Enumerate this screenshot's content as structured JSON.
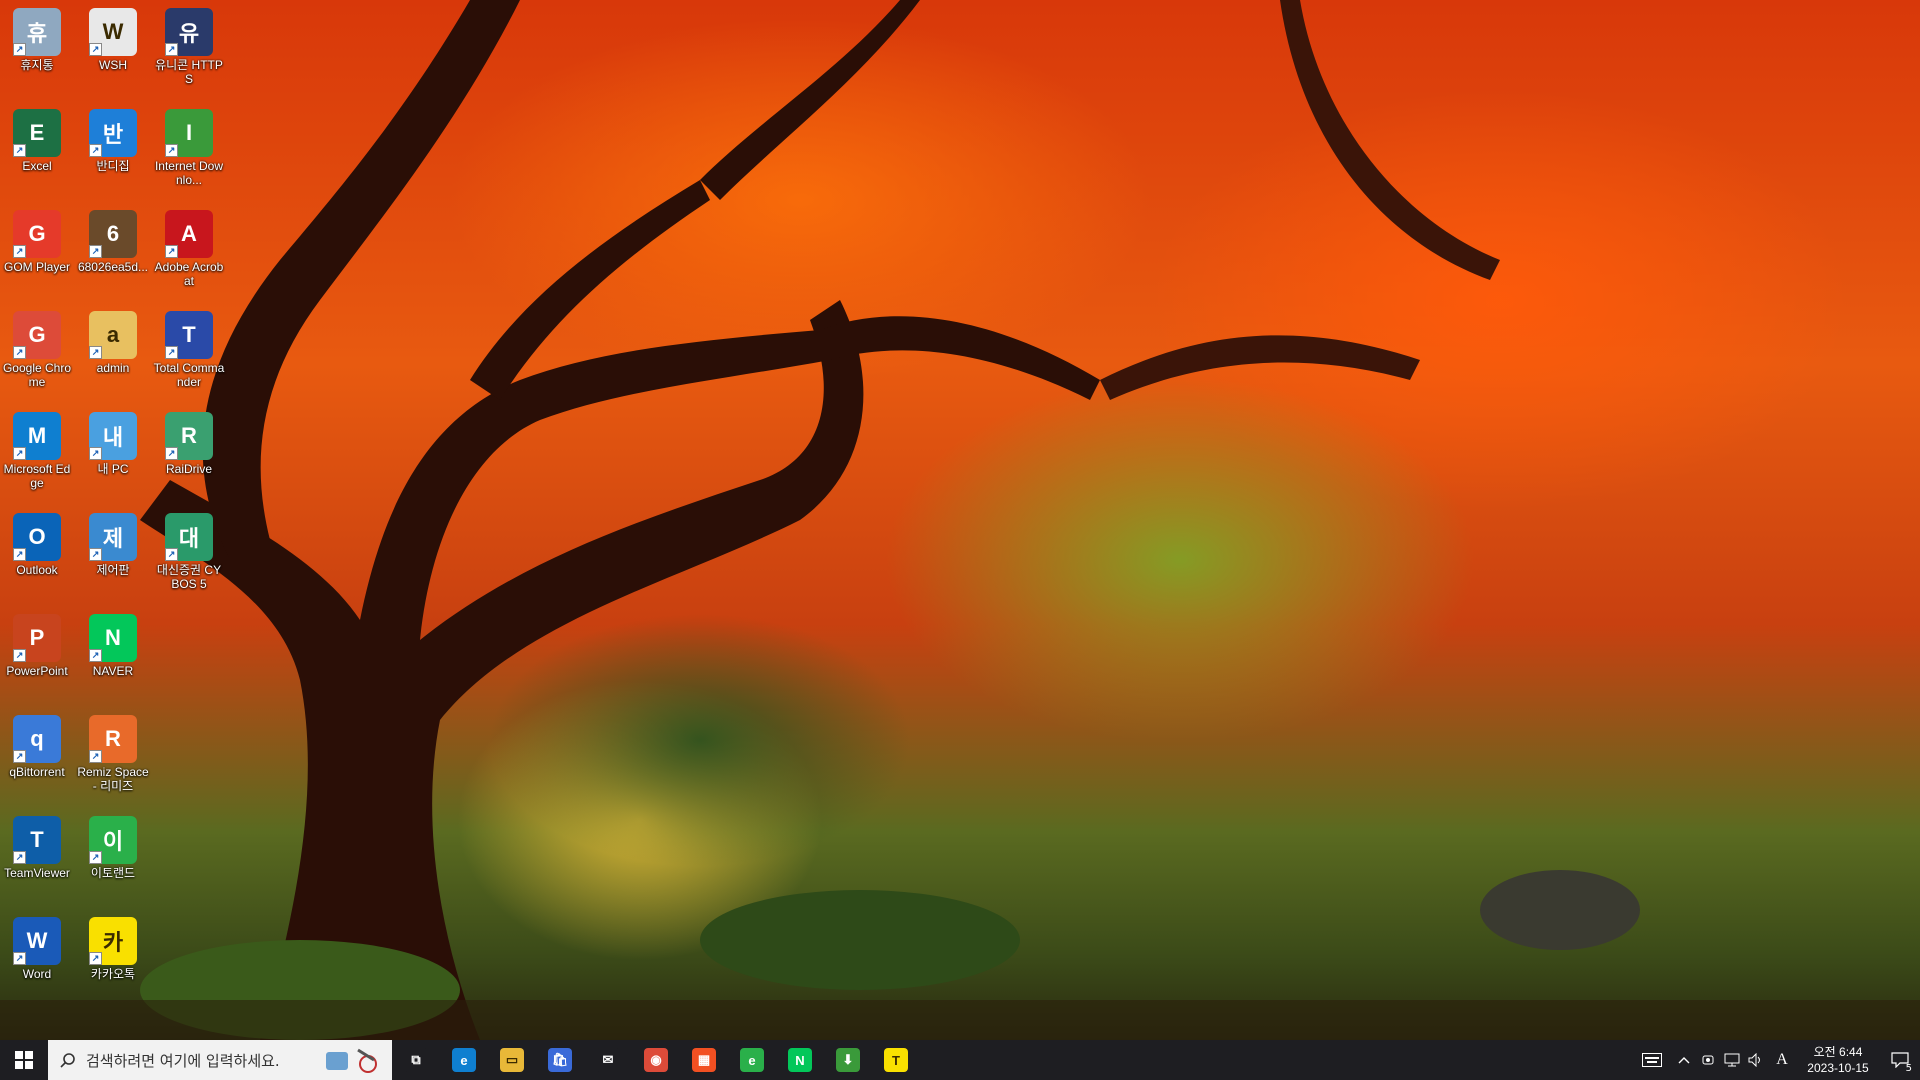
{
  "desktop": {
    "icons": [
      {
        "label": "휴지통",
        "icon": "recycle-bin-icon",
        "color": "#8fa8c0"
      },
      {
        "label": "WSH",
        "icon": "script-icon",
        "color": "#e8e8e8"
      },
      {
        "label": "유니콘 HTTPS",
        "icon": "unicorn-https-icon",
        "color": "#2a3a6a"
      },
      {
        "label": "Excel",
        "icon": "excel-icon",
        "color": "#1d7044"
      },
      {
        "label": "반디집",
        "icon": "bandizip-icon",
        "color": "#1e7fd8"
      },
      {
        "label": "Internet Downlo...",
        "icon": "idm-icon",
        "color": "#3a9a3a"
      },
      {
        "label": "GOM Player",
        "icon": "gom-player-icon",
        "color": "#e53a2a"
      },
      {
        "label": "68026ea5d...",
        "icon": "image-file-icon",
        "color": "#6a4a2a"
      },
      {
        "label": "Adobe Acrobat",
        "icon": "acrobat-icon",
        "color": "#c8161d"
      },
      {
        "label": "Google Chrome",
        "icon": "chrome-icon",
        "color": "#dd4b39"
      },
      {
        "label": "admin",
        "icon": "user-folder-icon",
        "color": "#e8c060"
      },
      {
        "label": "Total Commander",
        "icon": "total-commander-icon",
        "color": "#2a4aa8"
      },
      {
        "label": "Microsoft Edge",
        "icon": "edge-icon",
        "color": "#0f7fd0"
      },
      {
        "label": "내 PC",
        "icon": "this-pc-icon",
        "color": "#4aa0e0"
      },
      {
        "label": "RaiDrive",
        "icon": "raidrive-icon",
        "color": "#3aa070"
      },
      {
        "label": "Outlook",
        "icon": "outlook-icon",
        "color": "#0a64b8"
      },
      {
        "label": "제어판",
        "icon": "control-panel-icon",
        "color": "#3a8ad0"
      },
      {
        "label": "대신증권 CYBOS 5",
        "icon": "cybos-icon",
        "color": "#2a9a6a"
      },
      {
        "label": "PowerPoint",
        "icon": "powerpoint-icon",
        "color": "#c8441e"
      },
      {
        "label": "NAVER",
        "icon": "naver-icon",
        "color": "#03c75a"
      },
      {
        "label": "",
        "icon": "",
        "color": ""
      },
      {
        "label": "qBittorrent",
        "icon": "qbittorrent-icon",
        "color": "#3a7ad8"
      },
      {
        "label": "Remiz Space - 리미즈",
        "icon": "remiz-space-icon",
        "color": "#e86a2a"
      },
      {
        "label": "",
        "icon": "",
        "color": ""
      },
      {
        "label": "TeamViewer",
        "icon": "teamviewer-icon",
        "color": "#0e5ea8"
      },
      {
        "label": "이토랜드",
        "icon": "etoland-icon",
        "color": "#2ab04a"
      },
      {
        "label": "",
        "icon": "",
        "color": ""
      },
      {
        "label": "Word",
        "icon": "word-icon",
        "color": "#1a5ab8"
      },
      {
        "label": "카카오톡",
        "icon": "kakaotalk-icon",
        "color": "#f9e000"
      }
    ]
  },
  "taskbar": {
    "search_placeholder": "검색하려면 여기에 입력하세요.",
    "apps": [
      {
        "name": "task-view",
        "icon": "task-view-icon",
        "color": "#1e1e22",
        "glyph": "⧉"
      },
      {
        "name": "edge",
        "icon": "edge-icon",
        "color": "#0f7fd0",
        "glyph": "e"
      },
      {
        "name": "file-explorer",
        "icon": "folder-icon",
        "color": "#e8b838",
        "glyph": "▭"
      },
      {
        "name": "store",
        "icon": "store-icon",
        "color": "#3a6ad8",
        "glyph": "🛍"
      },
      {
        "name": "mail",
        "icon": "mail-icon",
        "color": "#1e1e22",
        "glyph": "✉"
      },
      {
        "name": "chrome",
        "icon": "chrome-icon",
        "color": "#dd4b39",
        "glyph": "◉"
      },
      {
        "name": "microsoft-apps",
        "icon": "windows-logo-icon",
        "color": "#f25022",
        "glyph": "▦"
      },
      {
        "name": "etoland",
        "icon": "etoland-icon",
        "color": "#2ab04a",
        "glyph": "e"
      },
      {
        "name": "naver",
        "icon": "naver-icon",
        "color": "#03c75a",
        "glyph": "N"
      },
      {
        "name": "internet-download-manager",
        "icon": "idm-icon",
        "color": "#3a9a3a",
        "glyph": "⬇"
      },
      {
        "name": "kakaotalk",
        "icon": "kakaotalk-icon",
        "color": "#f9e000",
        "glyph": "T"
      }
    ],
    "tray": {
      "ime_mode": "A",
      "time": "오전 6:44",
      "date": "2023-10-15",
      "notification_count": "5"
    }
  }
}
